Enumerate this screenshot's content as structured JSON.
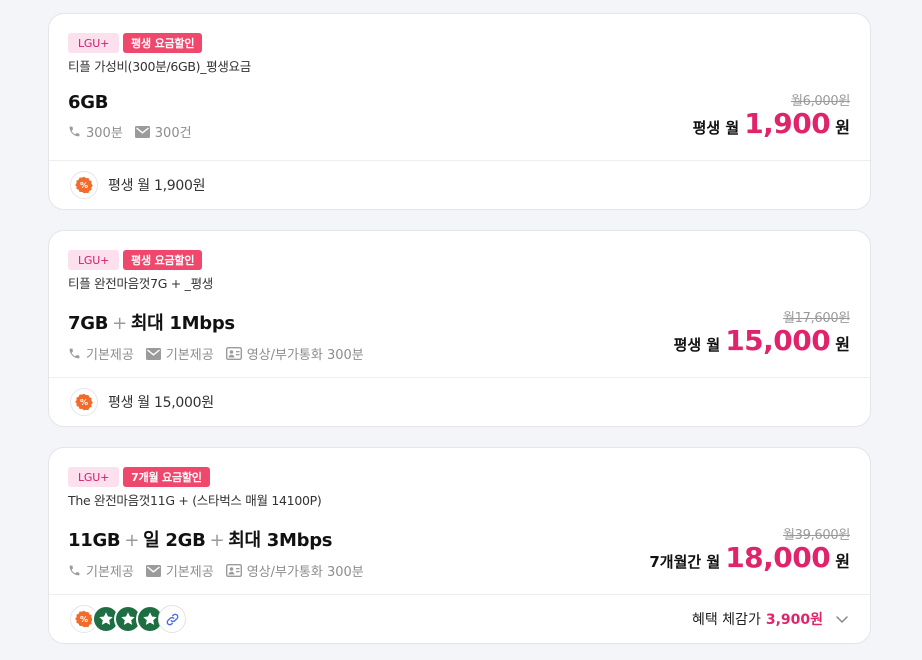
{
  "colors": {
    "accent": "#e0246b",
    "carrier_badge_bg": "#fde0ee",
    "promo_badge_bg": "#f0486d",
    "starbucks_green": "#1f6e43"
  },
  "plans": [
    {
      "carrier": "LGU+",
      "promo": "평생 요금할인",
      "name": "티플 가성비(300분/6GB)_평생요금",
      "data": "6GB",
      "features": [
        {
          "icon": "phone-icon",
          "text": "300분"
        },
        {
          "icon": "mail-icon",
          "text": "300건"
        }
      ],
      "original_price": "월6,000원",
      "price_prefix": "평생 월",
      "price": "1,900",
      "price_unit": "원",
      "benefit_text": "평생 월 1,900원"
    },
    {
      "carrier": "LGU+",
      "promo": "평생 요금할인",
      "name": "티플 완전마음껏7G + _평생",
      "data": "7GB",
      "data_extra": "최대 1Mbps",
      "features": [
        {
          "icon": "phone-icon",
          "text": "기본제공"
        },
        {
          "icon": "mail-icon",
          "text": "기본제공"
        },
        {
          "icon": "video-call-icon",
          "text": "영상/부가통화 300분"
        }
      ],
      "original_price": "월17,600원",
      "price_prefix": "평생 월",
      "price": "15,000",
      "price_unit": "원",
      "benefit_text": "평생 월 15,000원"
    },
    {
      "carrier": "LGU+",
      "promo": "7개월 요금할인",
      "name": "The 완전마음껏11G + (스타벅스 매월 14100P)",
      "data": "11GB",
      "data_daily": "일 2GB",
      "data_extra": "최대 3Mbps",
      "features": [
        {
          "icon": "phone-icon",
          "text": "기본제공"
        },
        {
          "icon": "mail-icon",
          "text": "기본제공"
        },
        {
          "icon": "video-call-icon",
          "text": "영상/부가통화 300분"
        }
      ],
      "original_price": "월39,600원",
      "price_prefix": "7개월간 월",
      "price": "18,000",
      "price_unit": "원",
      "benefit_label": "혜택 체감가",
      "benefit_price": "3,900원"
    }
  ]
}
